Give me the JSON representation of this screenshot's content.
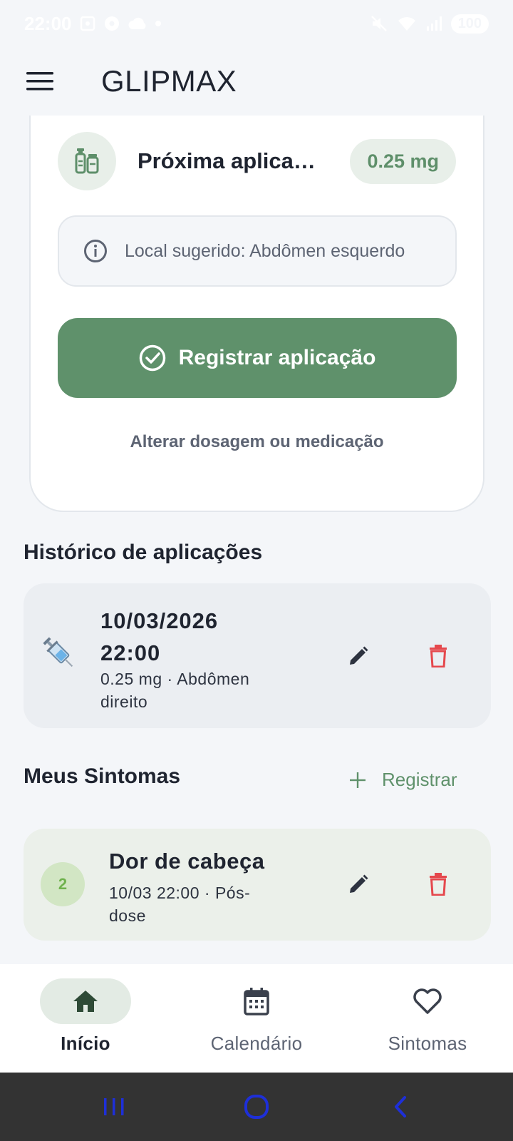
{
  "status_bar": {
    "time": "22:00",
    "battery": "100"
  },
  "app": {
    "title": "GLIPMAX",
    "menu_icon": "hamburger-menu-icon"
  },
  "next_application": {
    "title": "Próxima aplicação",
    "dose": "0.25 mg",
    "suggested_site": "Local sugerido: Abdômen esquerdo",
    "register_label": "Registrar aplicação",
    "change_link": "Alterar dosagem ou medicação"
  },
  "history": {
    "title": "Histórico de aplicações",
    "items": [
      {
        "icon": "syringe-icon",
        "date": "10/03/2026",
        "time": "22:00",
        "detail": "0.25 mg · Abdômen direito"
      }
    ]
  },
  "symptoms": {
    "title": "Meus Sintomas",
    "add_label": "Registrar",
    "items": [
      {
        "severity": "2",
        "name": "Dor de cabeça",
        "detail": "10/03   22:00 · Pós-dose"
      }
    ]
  },
  "bottom_nav": {
    "items": [
      {
        "label": "Início",
        "icon": "home-icon",
        "active": true
      },
      {
        "label": "Calendário",
        "icon": "calendar-icon",
        "active": false
      },
      {
        "label": "Sintomas",
        "icon": "heart-icon",
        "active": false
      }
    ]
  },
  "colors": {
    "accent": "#5f916b",
    "delete": "#e5484d",
    "background": "#f4f6f9"
  }
}
